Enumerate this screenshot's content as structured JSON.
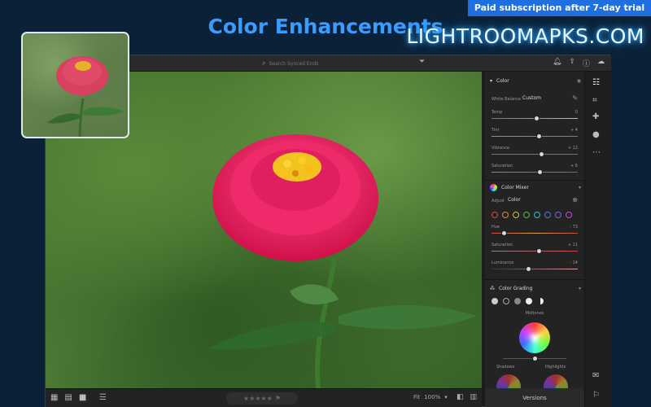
{
  "promo": {
    "banner_text": "Paid subscription after 7-day trial"
  },
  "headline": {
    "text": "Color Enhancements"
  },
  "brand": {
    "text": "LIGHTROOMAPKS.COM"
  },
  "topbar": {
    "search_placeholder": "Search Synced Ends",
    "icons": [
      "search-icon",
      "filter-icon",
      "bell-icon",
      "share-icon",
      "help-icon",
      "cloud-icon"
    ]
  },
  "bottombar": {
    "view_icons": [
      "square-grid-icon",
      "grid-icon",
      "single-view-icon"
    ],
    "fit_label": "Fit",
    "zoom": "100%",
    "stars": "★★★★★"
  },
  "panel": {
    "color": {
      "title": "Color",
      "white_balance_label": "White Balance",
      "white_balance_value": "Custom",
      "temp_label": "Temp",
      "temp_value": "0",
      "tint_label": "Tint",
      "tint_value": "+ 4",
      "vibrance_label": "Vibrance",
      "vibrance_value": "+ 12",
      "saturation_label": "Saturation",
      "saturation_value": "+ 6"
    },
    "mixer": {
      "title": "Color Mixer",
      "adjust_label": "Adjust",
      "adjust_value": "Color",
      "swatch_colors": [
        "#e04848",
        "#e08a3a",
        "#d6c43a",
        "#4cc04c",
        "#3ac0c0",
        "#4a7ae0",
        "#8a5ae0",
        "#c84ad0"
      ],
      "hue_label": "Hue",
      "hue_value": "- 73",
      "saturation_label": "Saturation",
      "saturation_value": "+ 11",
      "luminance_label": "Luminance",
      "luminance_value": "- 14"
    },
    "grading": {
      "title": "Color Grading",
      "midtones_label": "Midtones",
      "shadows_label": "Shadows",
      "highlights_label": "Highlights"
    },
    "versions_label": "Versions"
  }
}
